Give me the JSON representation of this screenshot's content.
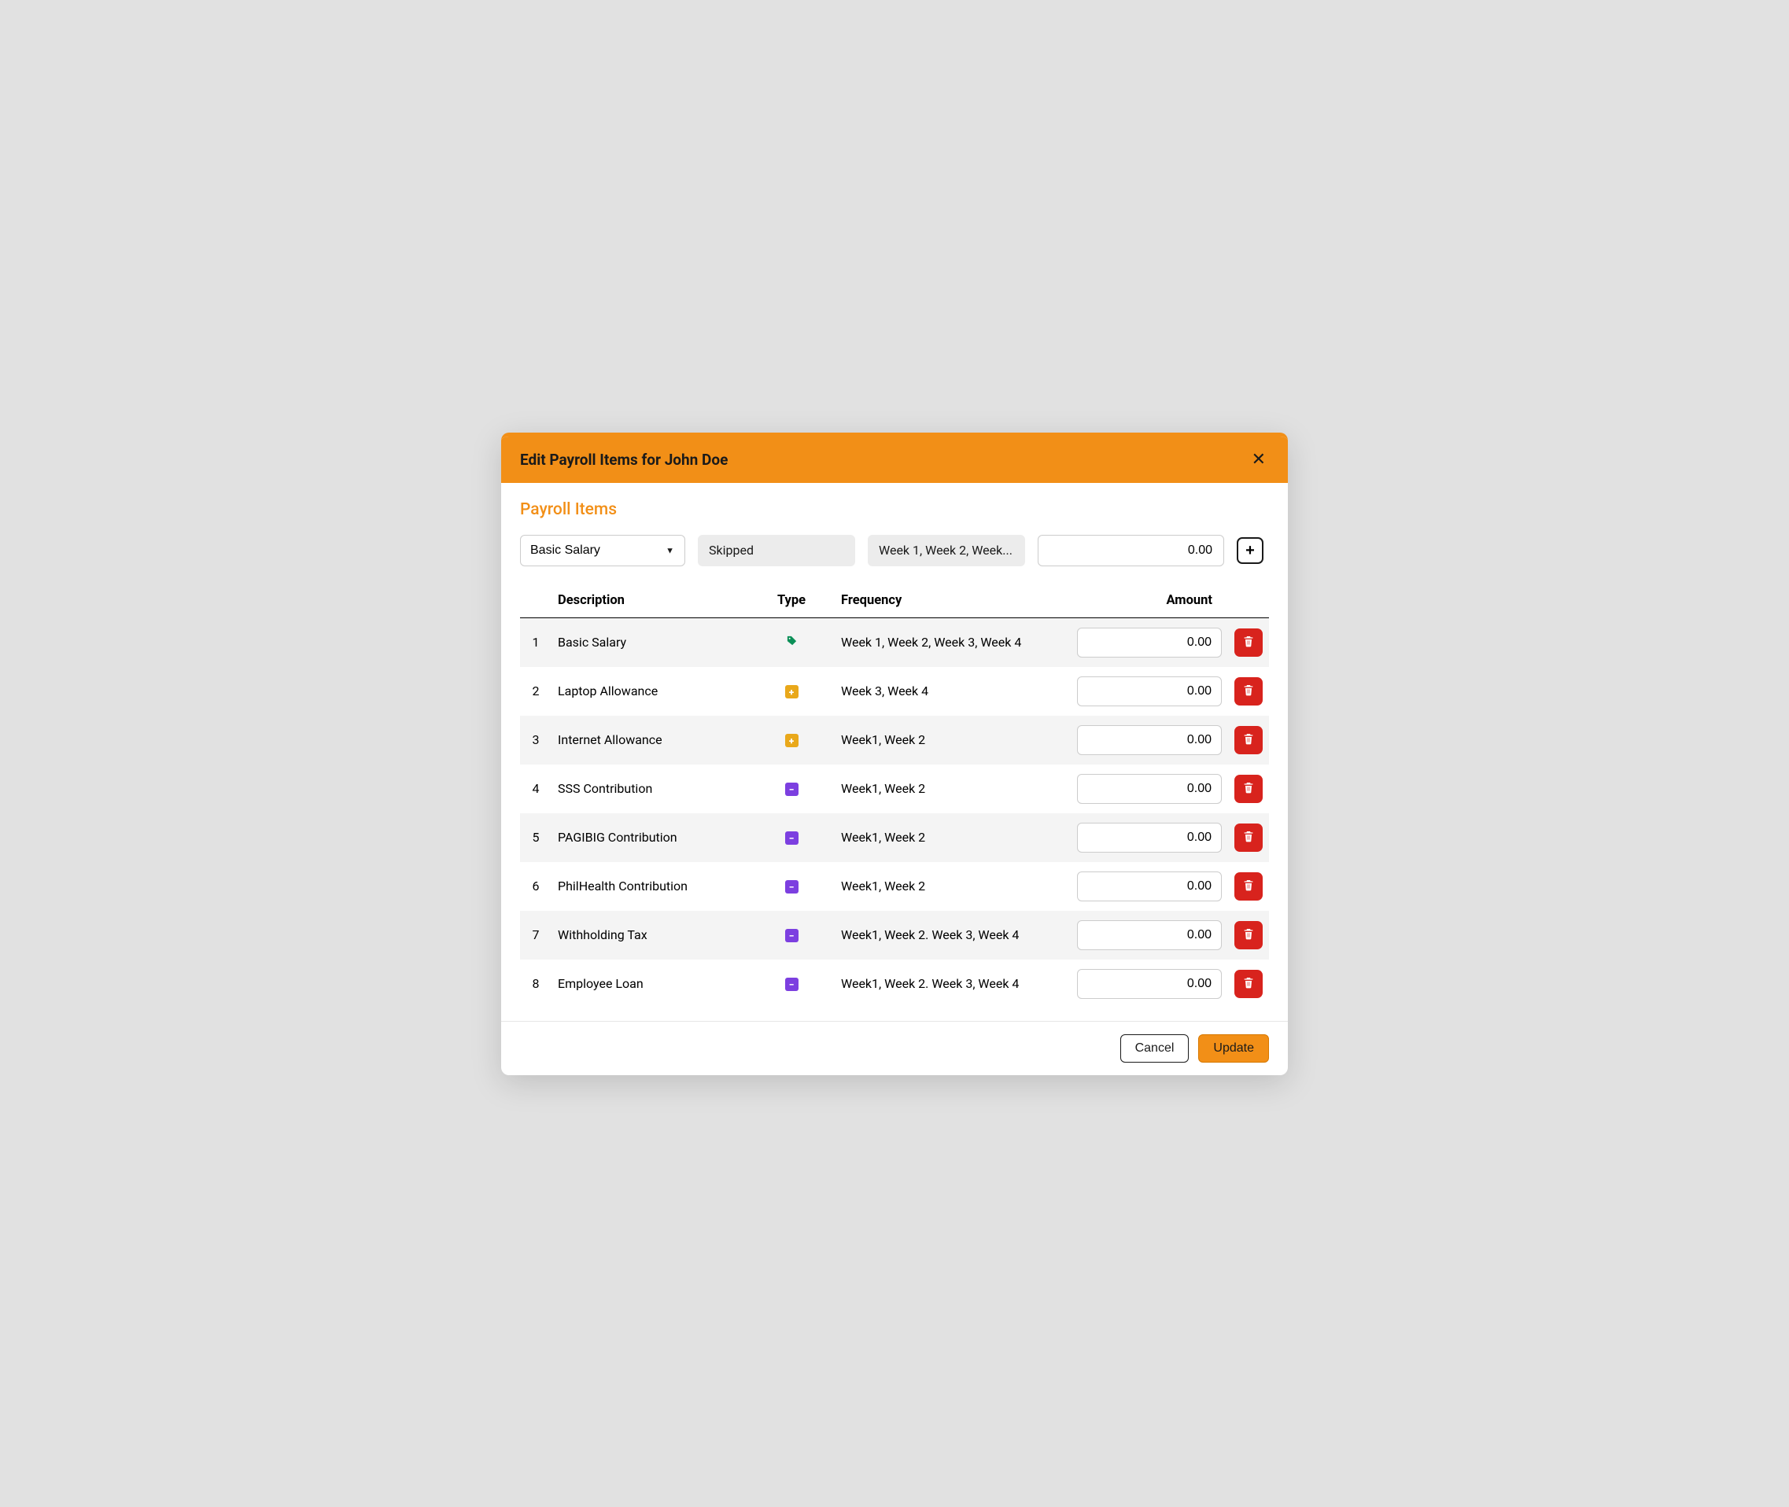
{
  "modal": {
    "title": "Edit Payroll Items for John Doe",
    "section_title": "Payroll Items"
  },
  "controls": {
    "description_select": "Basic Salary",
    "type_chip": "Skipped",
    "frequency_chip": "Week 1, Week 2, Week...",
    "amount_value": "0.00"
  },
  "columns": {
    "num": "",
    "description": "Description",
    "type": "Type",
    "frequency": "Frequency",
    "amount": "Amount",
    "action": ""
  },
  "rows": [
    {
      "n": "1",
      "description": "Basic Salary",
      "type": "tag",
      "frequency": "Week 1, Week 2, Week 3, Week 4",
      "amount": "0.00"
    },
    {
      "n": "2",
      "description": "Laptop Allowance",
      "type": "plus",
      "frequency": "Week 3, Week 4",
      "amount": "0.00"
    },
    {
      "n": "3",
      "description": "Internet Allowance",
      "type": "plus",
      "frequency": "Week1, Week 2",
      "amount": "0.00"
    },
    {
      "n": "4",
      "description": "SSS Contribution",
      "type": "minus",
      "frequency": "Week1, Week 2",
      "amount": "0.00"
    },
    {
      "n": "5",
      "description": "PAGIBIG Contribution",
      "type": "minus",
      "frequency": "Week1, Week 2",
      "amount": "0.00"
    },
    {
      "n": "6",
      "description": "PhilHealth Contribution",
      "type": "minus",
      "frequency": "Week1, Week 2",
      "amount": "0.00"
    },
    {
      "n": "7",
      "description": "Withholding Tax",
      "type": "minus",
      "frequency": "Week1, Week 2. Week 3, Week 4",
      "amount": "0.00"
    },
    {
      "n": "8",
      "description": "Employee Loan",
      "type": "minus",
      "frequency": "Week1, Week 2. Week 3, Week 4",
      "amount": "0.00"
    }
  ],
  "type_styles": {
    "plus": {
      "glyph": "+",
      "bg": "#e9a81a"
    },
    "minus": {
      "glyph": "−",
      "bg": "#7c3fe0"
    }
  },
  "footer": {
    "cancel": "Cancel",
    "update": "Update"
  }
}
